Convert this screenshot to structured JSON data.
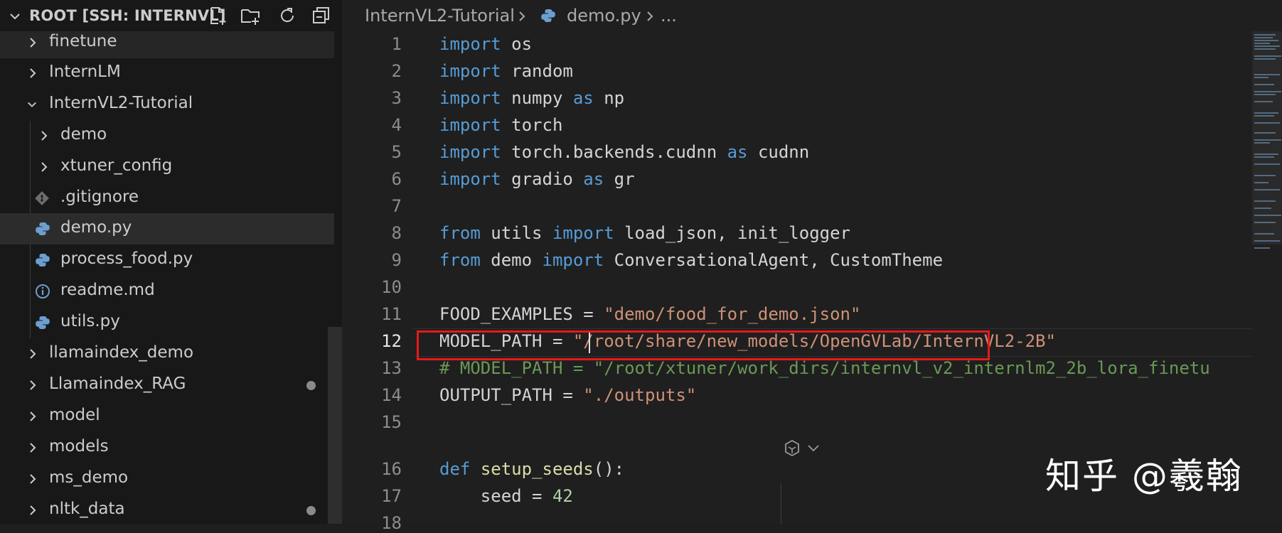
{
  "sidebar": {
    "title": "ROOT [SSH: INTERNVL]",
    "header_icons": [
      "new-file-icon",
      "new-folder-icon",
      "refresh-icon",
      "collapse-all-icon"
    ],
    "items": [
      {
        "label": "finetune",
        "type": "folder",
        "expanded": false,
        "level": 0
      },
      {
        "label": "InternLM",
        "type": "folder",
        "expanded": false,
        "level": 0
      },
      {
        "label": "InternVL2-Tutorial",
        "type": "folder",
        "expanded": true,
        "level": 0
      },
      {
        "label": "demo",
        "type": "folder",
        "expanded": false,
        "level": 1
      },
      {
        "label": "xtuner_config",
        "type": "folder",
        "expanded": false,
        "level": 1
      },
      {
        "label": ".gitignore",
        "type": "git-file",
        "level": 1
      },
      {
        "label": "demo.py",
        "type": "python-file",
        "level": 1,
        "selected": true
      },
      {
        "label": "process_food.py",
        "type": "python-file",
        "level": 1
      },
      {
        "label": "readme.md",
        "type": "info-file",
        "level": 1
      },
      {
        "label": "utils.py",
        "type": "python-file",
        "level": 1
      },
      {
        "label": "llamaindex_demo",
        "type": "folder",
        "expanded": false,
        "level": 0
      },
      {
        "label": "Llamaindex_RAG",
        "type": "folder",
        "expanded": false,
        "level": 0,
        "modified": true
      },
      {
        "label": "model",
        "type": "folder",
        "expanded": false,
        "level": 0
      },
      {
        "label": "models",
        "type": "folder",
        "expanded": false,
        "level": 0
      },
      {
        "label": "ms_demo",
        "type": "folder",
        "expanded": false,
        "level": 0
      },
      {
        "label": "nltk_data",
        "type": "folder",
        "expanded": false,
        "level": 0,
        "modified": true
      }
    ]
  },
  "breadcrumb": {
    "folder": "InternVL2-Tutorial",
    "file": "demo.py",
    "more": "..."
  },
  "editor": {
    "active_line": "12",
    "lines": [
      {
        "n": "1",
        "tokens": [
          [
            "kw",
            "import"
          ],
          [
            "id",
            " os"
          ]
        ]
      },
      {
        "n": "2",
        "tokens": [
          [
            "kw",
            "import"
          ],
          [
            "id",
            " random"
          ]
        ]
      },
      {
        "n": "3",
        "tokens": [
          [
            "kw",
            "import"
          ],
          [
            "id",
            " numpy "
          ],
          [
            "kw",
            "as"
          ],
          [
            "id",
            " np"
          ]
        ]
      },
      {
        "n": "4",
        "tokens": [
          [
            "kw",
            "import"
          ],
          [
            "id",
            " torch"
          ]
        ]
      },
      {
        "n": "5",
        "tokens": [
          [
            "kw",
            "import"
          ],
          [
            "id",
            " torch.backends.cudnn "
          ],
          [
            "kw",
            "as"
          ],
          [
            "id",
            " cudnn"
          ]
        ]
      },
      {
        "n": "6",
        "tokens": [
          [
            "kw",
            "import"
          ],
          [
            "id",
            " gradio "
          ],
          [
            "kw",
            "as"
          ],
          [
            "id",
            " gr"
          ]
        ]
      },
      {
        "n": "7",
        "tokens": []
      },
      {
        "n": "8",
        "tokens": [
          [
            "kw",
            "from"
          ],
          [
            "id",
            " utils "
          ],
          [
            "kw",
            "import"
          ],
          [
            "id",
            " load_json, init_logger"
          ]
        ]
      },
      {
        "n": "9",
        "tokens": [
          [
            "kw",
            "from"
          ],
          [
            "id",
            " demo "
          ],
          [
            "kw",
            "import"
          ],
          [
            "id",
            " ConversationalAgent, CustomTheme"
          ]
        ]
      },
      {
        "n": "10",
        "tokens": []
      },
      {
        "n": "11",
        "tokens": [
          [
            "id",
            "FOOD_EXAMPLES = "
          ],
          [
            "str",
            "\"demo/food_for_demo.json\""
          ]
        ]
      },
      {
        "n": "12",
        "tokens": [
          [
            "id",
            "MODEL_PATH = "
          ],
          [
            "str",
            "\"/root/share/new_models/OpenGVLab/InternVL2-2B\""
          ]
        ]
      },
      {
        "n": "13",
        "tokens": [
          [
            "cmt",
            "# MODEL_PATH = \"/root/xtuner/work_dirs/internvl_v2_internlm2_2b_lora_finetu"
          ]
        ]
      },
      {
        "n": "14",
        "tokens": [
          [
            "id",
            "OUTPUT_PATH = "
          ],
          [
            "str",
            "\"./outputs\""
          ]
        ]
      },
      {
        "n": "15",
        "tokens": []
      },
      {
        "n": "16",
        "tokens": [
          [
            "kw",
            "def"
          ],
          [
            "id",
            " "
          ],
          [
            "fn",
            "setup_seeds"
          ],
          [
            "id",
            "():"
          ]
        ]
      },
      {
        "n": "17",
        "tokens": [
          [
            "id",
            "    seed = "
          ],
          [
            "num",
            "42"
          ]
        ]
      },
      {
        "n": "18",
        "tokens": []
      }
    ]
  },
  "colors": {
    "keyword": "#569cd6",
    "string": "#ce9178",
    "number": "#b5cea8",
    "comment": "#6a9955",
    "function": "#dcdcaa",
    "highlight_box": "#e5191b"
  },
  "watermark": "知乎 @羲翰"
}
